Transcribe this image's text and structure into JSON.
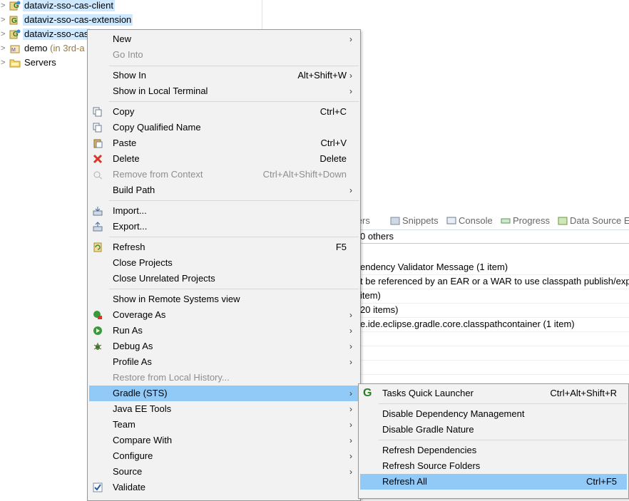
{
  "tree": {
    "items": [
      {
        "label": "dataviz-sso-cas-client",
        "suffix": "",
        "icon": "gradle-project-icon",
        "selected": true
      },
      {
        "label": "dataviz-sso-cas-extension",
        "suffix": "",
        "icon": "gradle-project-icon",
        "selected": true
      },
      {
        "label": "dataviz-sso-cas",
        "suffix": "",
        "icon": "gradle-project-icon",
        "selected": true
      },
      {
        "label": "demo",
        "suffix": "(in 3rd-a",
        "icon": "maven-project-icon",
        "selected": false
      },
      {
        "label": "Servers",
        "suffix": "",
        "icon": "folder-icon",
        "selected": false
      }
    ]
  },
  "views": {
    "tabs": [
      "rvers",
      "Snippets",
      "Console",
      "Progress",
      "Data Source E"
    ],
    "summary": "0 others",
    "rows": [
      "endency Validator Message (1 item)",
      "t be referenced by an EAR or a WAR to use classpath publish/exp",
      "item)",
      "20 items)",
      "e.ide.eclipse.gradle.core.classpathcontainer (1 item)",
      "",
      "",
      ""
    ]
  },
  "menu": {
    "items": {
      "new": "New",
      "go_into": "Go Into",
      "show_in": "Show In",
      "show_in_accel": "Alt+Shift+W",
      "show_in_terminal": "Show in Local Terminal",
      "copy": "Copy",
      "copy_accel": "Ctrl+C",
      "copy_qualified": "Copy Qualified Name",
      "paste": "Paste",
      "paste_accel": "Ctrl+V",
      "delete": "Delete",
      "delete_accel": "Delete",
      "remove_context": "Remove from Context",
      "remove_context_accel": "Ctrl+Alt+Shift+Down",
      "build_path": "Build Path",
      "import": "Import...",
      "export": "Export...",
      "refresh": "Refresh",
      "refresh_accel": "F5",
      "close_projects": "Close Projects",
      "close_unrelated": "Close Unrelated Projects",
      "show_remote": "Show in Remote Systems view",
      "coverage_as": "Coverage As",
      "run_as": "Run As",
      "debug_as": "Debug As",
      "profile_as": "Profile As",
      "restore_history": "Restore from Local History...",
      "gradle": "Gradle (STS)",
      "java_ee_tools": "Java EE Tools",
      "team": "Team",
      "compare_with": "Compare With",
      "configure": "Configure",
      "source": "Source",
      "validate": "Validate"
    }
  },
  "submenu": {
    "tasks_launcher": "Tasks Quick Launcher",
    "tasks_launcher_accel": "Ctrl+Alt+Shift+R",
    "disable_dep_mgmt": "Disable Dependency Management",
    "disable_nature": "Disable Gradle Nature",
    "refresh_deps": "Refresh Dependencies",
    "refresh_sources": "Refresh Source Folders",
    "refresh_all": "Refresh All",
    "refresh_all_accel": "Ctrl+F5"
  },
  "colors": {
    "selection": "#cde8ff",
    "menu_highlight": "#91c9f7",
    "menu_bg": "#f2f2f2"
  }
}
